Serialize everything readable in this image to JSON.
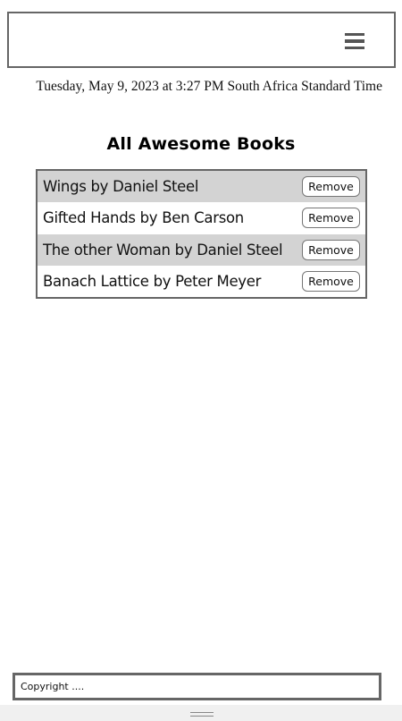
{
  "header": {
    "menu_icon": "hamburger-menu-icon"
  },
  "date_text": "Tuesday, May 9, 2023 at 3:27 PM South Africa Standard Time",
  "section_title": "All Awesome Books",
  "books": [
    {
      "text": "Wings by Daniel Steel",
      "button": "Remove"
    },
    {
      "text": "Gifted Hands by Ben Carson",
      "button": "Remove"
    },
    {
      "text": "The other Woman by Daniel Steel",
      "button": "Remove"
    },
    {
      "text": "Banach Lattice by Peter Meyer",
      "button": "Remove"
    }
  ],
  "footer": {
    "text": "Copyright ...."
  },
  "colors": {
    "border": "#666666",
    "shaded_row": "#d3d3d3",
    "bottom_bar": "#f0f0f0"
  }
}
